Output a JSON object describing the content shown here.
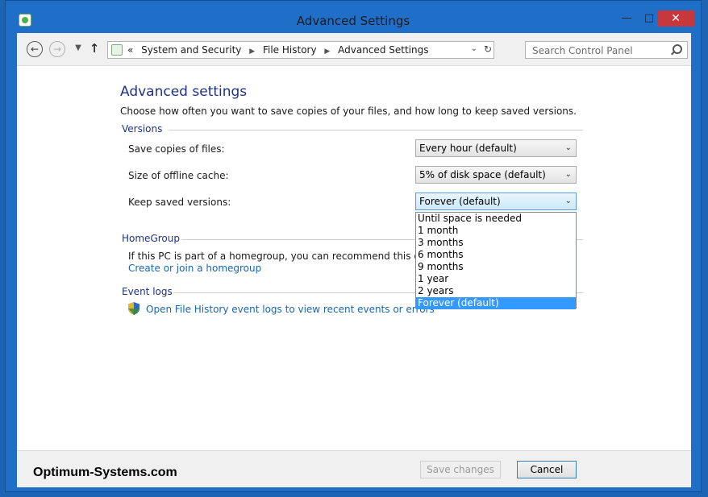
{
  "window": {
    "title": "Advanced Settings"
  },
  "nav": {
    "breadcrumbs": [
      "System and Security",
      "File History",
      "Advanced Settings"
    ],
    "breadcrumb_prefix": "«",
    "search_placeholder": "Search Control Panel"
  },
  "page": {
    "heading": "Advanced settings",
    "description": "Choose how often you want to save copies of your files, and how long to keep saved versions."
  },
  "versions": {
    "group_title": "Versions",
    "save_copies": {
      "label": "Save copies of files:",
      "value": "Every hour (default)"
    },
    "offline_cache": {
      "label": "Size of offline cache:",
      "value": "5% of disk space (default)"
    },
    "keep_versions": {
      "label": "Keep saved versions:",
      "value": "Forever (default)",
      "options": [
        "Until space is needed",
        "1 month",
        "3 months",
        "6 months",
        "9 months",
        "1 year",
        "2 years",
        "Forever (default)"
      ],
      "selected_index": 7
    }
  },
  "homegroup": {
    "group_title": "HomeGroup",
    "text": "If this PC is part of a homegroup, you can recommend this drive to",
    "link": "Create or join a homegroup"
  },
  "event_logs": {
    "group_title": "Event logs",
    "link": "Open File History event logs to view recent events or errors"
  },
  "footer": {
    "brand": "Optimum-Systems.com",
    "save_label": "Save changes",
    "cancel_label": "Cancel"
  },
  "colors": {
    "accent": "#1e3287",
    "link": "#1a65b0",
    "selection": "#3399ff",
    "close": "#c7373b"
  }
}
